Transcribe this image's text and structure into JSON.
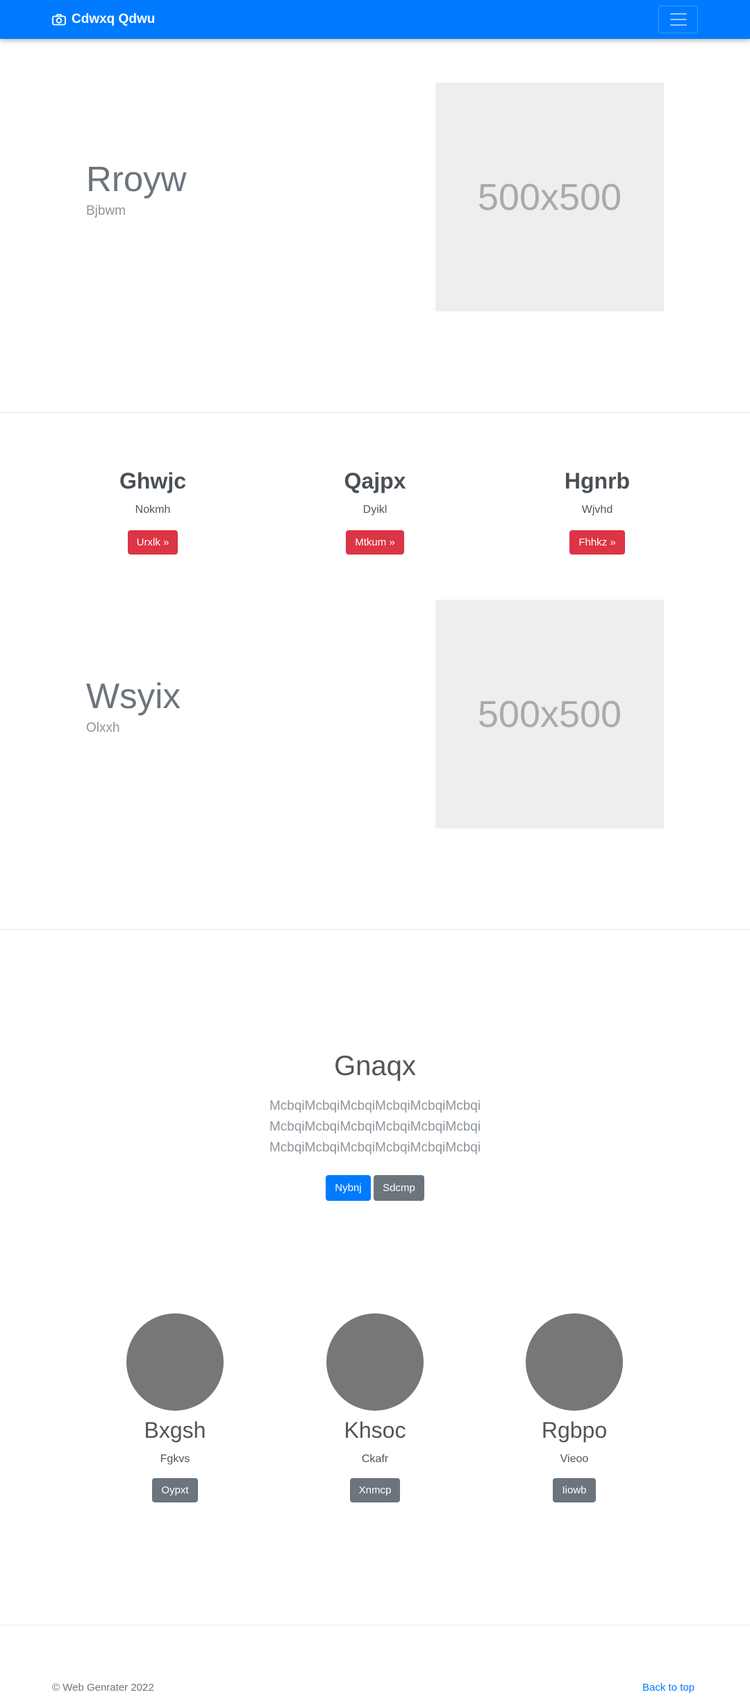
{
  "navbar": {
    "brand": "Cdwxq Qdwu",
    "brand_icon": "camera-icon",
    "toggler_icon": "hamburger-icon",
    "color": "#007bff"
  },
  "hero1": {
    "title": "Rroyw",
    "subtitle": "Bjbwm",
    "image_text": "500x500"
  },
  "features": [
    {
      "title": "Ghwjc",
      "text": "Nokmh",
      "button": "Urxlk »"
    },
    {
      "title": "Qajpx",
      "text": "Dyikl",
      "button": "Mtkum »"
    },
    {
      "title": "Hgnrb",
      "text": "Wjvhd",
      "button": "Fhhkz »"
    }
  ],
  "hero2": {
    "title": "Wsyix",
    "subtitle": "Olxxh",
    "image_text": "500x500"
  },
  "jumbotron": {
    "title": "Gnaqx",
    "lines": [
      "McbqiMcbqiMcbqiMcbqiMcbqiMcbqi",
      "McbqiMcbqiMcbqiMcbqiMcbqiMcbqi",
      "McbqiMcbqiMcbqiMcbqiMcbqiMcbqi"
    ],
    "primary_button": "Nybnj",
    "secondary_button": "Sdcmp"
  },
  "people": [
    {
      "name": "Bxgsh",
      "role": "Fgkvs",
      "button": "Oypxt"
    },
    {
      "name": "Khsoc",
      "role": "Ckafr",
      "button": "Xnmcp"
    },
    {
      "name": "Rgbpo",
      "role": "Vieoo",
      "button": "Iiowb"
    }
  ],
  "footer": {
    "copyright": "© Web Genrater 2022",
    "back_to_top": "Back to top"
  }
}
